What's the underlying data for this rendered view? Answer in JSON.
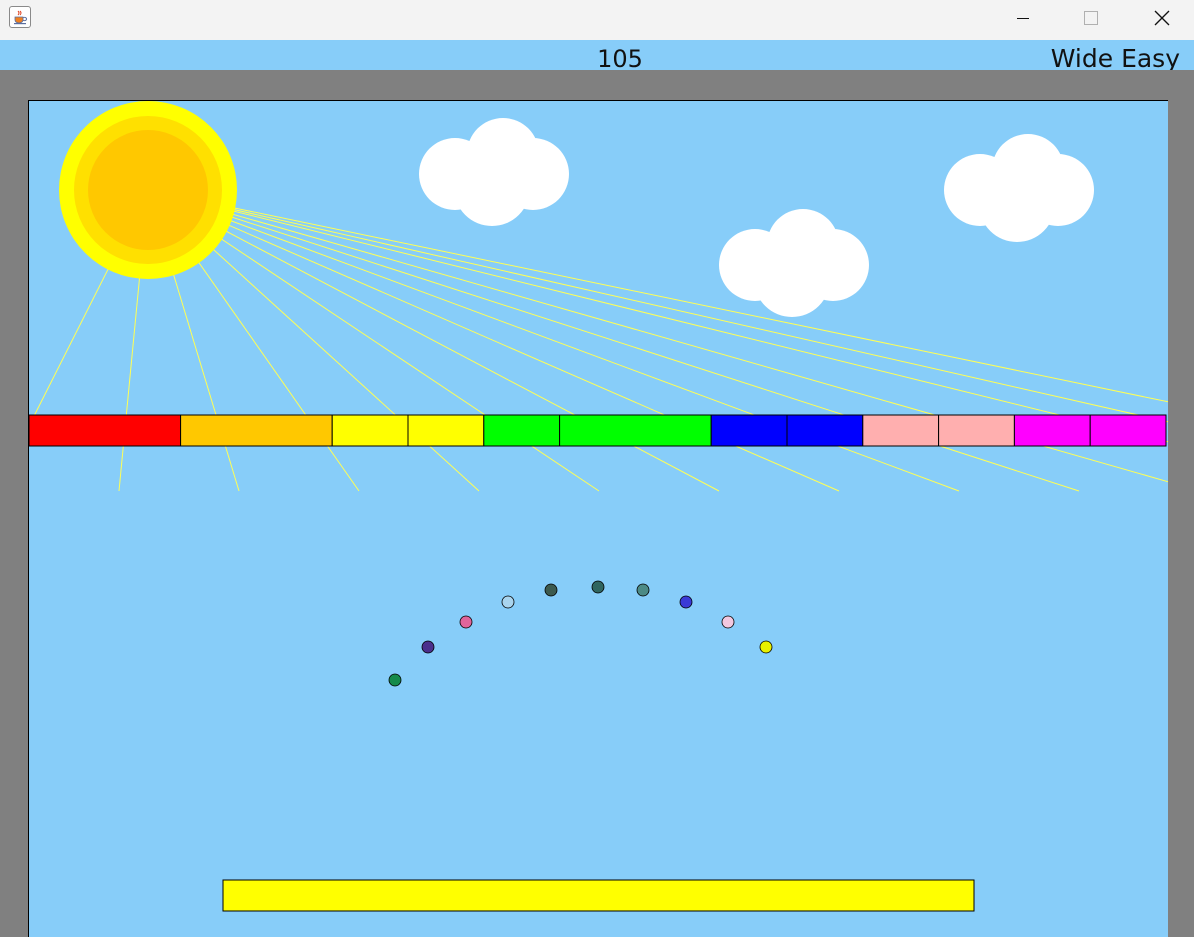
{
  "window": {
    "app_icon": "java-cup-icon",
    "controls": [
      "minimize-icon",
      "maximize-icon",
      "close-icon"
    ]
  },
  "hud": {
    "score": "105",
    "mode": "Wide Easy"
  },
  "scene": {
    "sky_color": "#87cdf9",
    "sun_colors": [
      "#ffff00",
      "#ffe000",
      "#ffc800"
    ],
    "ray_color": "#ffff55",
    "cloud_color": "#ffffff"
  },
  "bricks": [
    {
      "color": "#ff0000",
      "width": 2
    },
    {
      "color": "#ffc800",
      "width": 2
    },
    {
      "color": "#ffff00",
      "width": 1
    },
    {
      "color": "#ffff00",
      "width": 1
    },
    {
      "color": "#00ff00",
      "width": 1
    },
    {
      "color": "#00ff00",
      "width": 2
    },
    {
      "color": "#0000ff",
      "width": 1
    },
    {
      "color": "#0000ff",
      "width": 1
    },
    {
      "color": "#ffafaf",
      "width": 1
    },
    {
      "color": "#ffafaf",
      "width": 1
    },
    {
      "color": "#ff00ff",
      "width": 1
    },
    {
      "color": "#ff00ff",
      "width": 1
    }
  ],
  "balls": [
    {
      "color": "#158a4a"
    },
    {
      "color": "#4a2f8c"
    },
    {
      "color": "#e0649b"
    },
    {
      "color": "#a9d4ee"
    },
    {
      "color": "#3c5a4f"
    },
    {
      "color": "#2f6560"
    },
    {
      "color": "#4c8a86"
    },
    {
      "color": "#3a3ad6"
    },
    {
      "color": "#f2c8e0"
    },
    {
      "color": "#e8f000"
    }
  ],
  "paddle": {
    "color": "#ffff00"
  }
}
